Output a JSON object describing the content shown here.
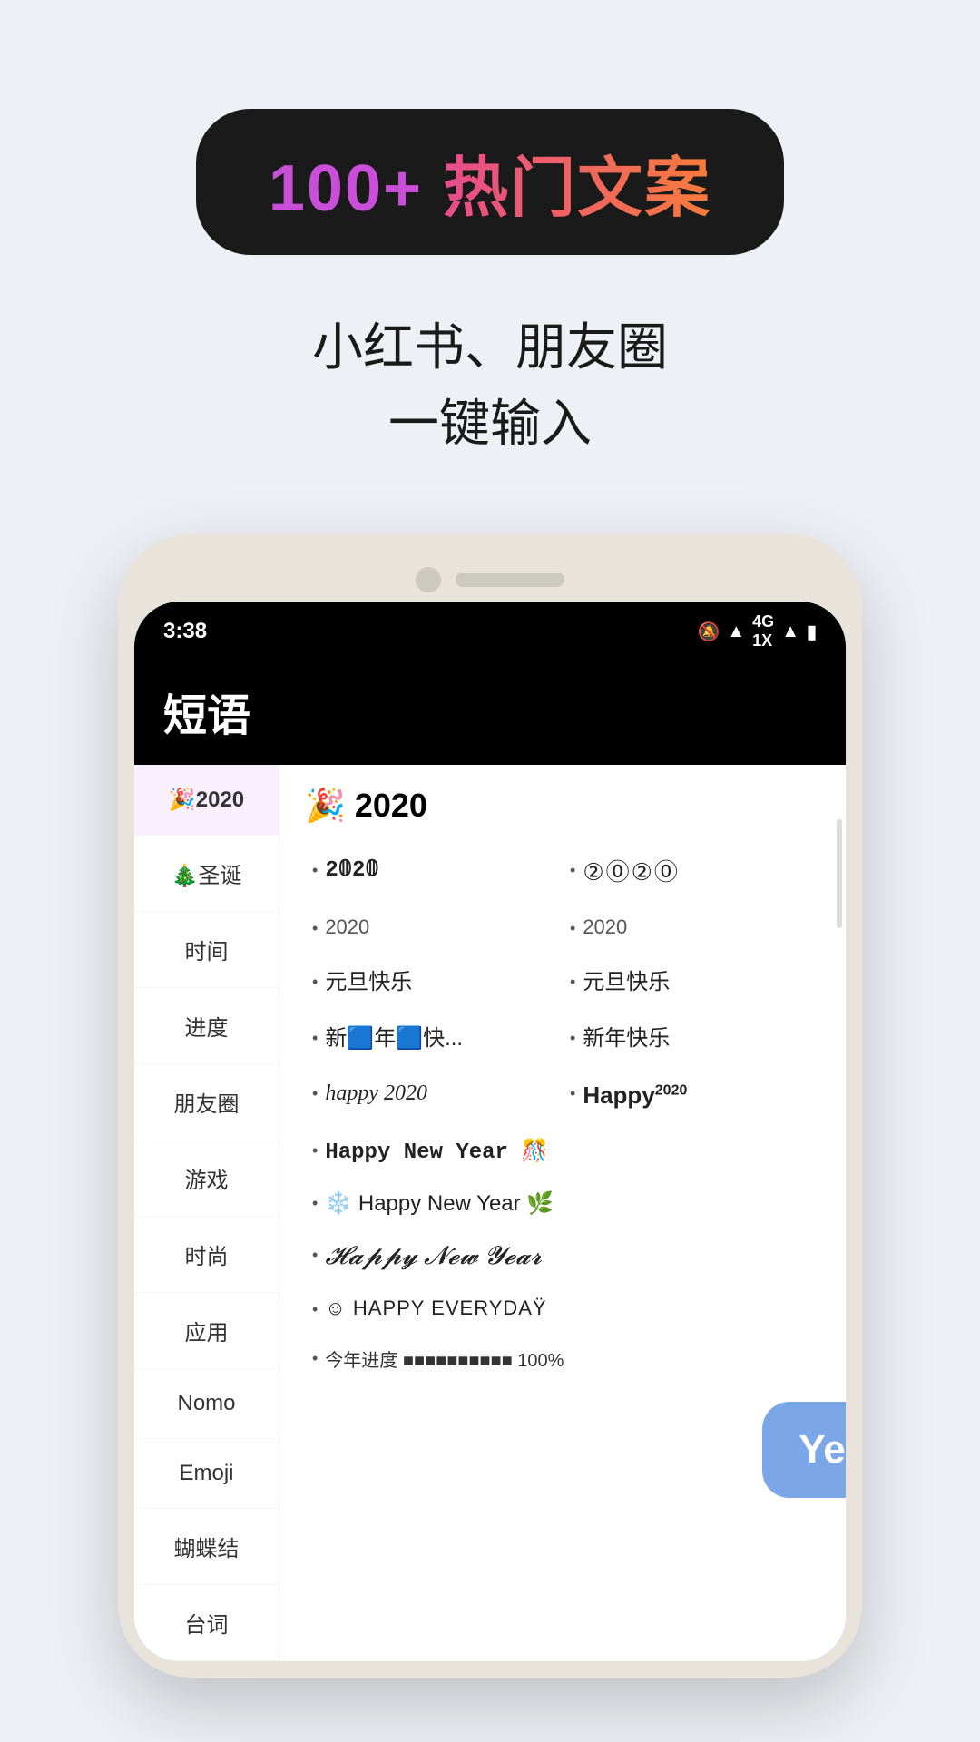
{
  "page": {
    "background": "#eef0f5"
  },
  "header": {
    "badge": {
      "num_text": "100+",
      "cn_text": " 热门文案"
    },
    "subtitle_line1": "小红书、朋友圈",
    "subtitle_line2": "一键输入"
  },
  "phone": {
    "status_bar": {
      "time": "3:38",
      "icons": "🔕 📶 4G 1x 📶 🔋"
    },
    "app_title": "短语",
    "sidebar": {
      "items": [
        {
          "id": "2020",
          "label": "🎉2020",
          "active": true
        },
        {
          "id": "christmas",
          "label": "🎄圣诞"
        },
        {
          "id": "time",
          "label": "时间"
        },
        {
          "id": "progress",
          "label": "进度"
        },
        {
          "id": "friends",
          "label": "朋友圈"
        },
        {
          "id": "games",
          "label": "游戏"
        },
        {
          "id": "fashion",
          "label": "时尚"
        },
        {
          "id": "apps",
          "label": "应用"
        },
        {
          "id": "nomo",
          "label": "Nomo"
        },
        {
          "id": "emoji",
          "label": "Emoji"
        },
        {
          "id": "bowknot",
          "label": "蝴蝶结"
        },
        {
          "id": "lines",
          "label": "台词"
        }
      ]
    },
    "content": {
      "section_title": "🎉 2020",
      "items": [
        {
          "col": 1,
          "text": "2𝟘2𝟘",
          "style": "typewriter"
        },
        {
          "col": 2,
          "text": "②⓪②⓪",
          "style": "circled"
        },
        {
          "col": 1,
          "text": "2020",
          "style": "small-cn"
        },
        {
          "col": 2,
          "text": "2020",
          "style": "small-cn"
        },
        {
          "col": 1,
          "text": "元旦快乐",
          "style": "normal"
        },
        {
          "col": 2,
          "text": "元旦快乐",
          "style": "normal"
        },
        {
          "col": 1,
          "text": "新🟦年🟦快...",
          "style": "normal"
        },
        {
          "col": 2,
          "text": "新年快乐",
          "style": "normal"
        },
        {
          "col": 1,
          "text": "happy 2020",
          "style": "script"
        },
        {
          "col": 2,
          "text": "Happy²⁰²⁰",
          "style": "bold-happy"
        },
        {
          "full": true,
          "text": "Happy New Year 🎊",
          "style": "typewriter"
        },
        {
          "full": true,
          "text": "❄️ Happy New Year 🌿",
          "style": "normal"
        },
        {
          "full": true,
          "text": "𝓗𝓪𝓹𝓹𝔂 𝓝𝓮𝔀 𝓨𝓮𝓪𝓻",
          "style": "cursive-happy"
        },
        {
          "full": true,
          "text": "☺ HAPPY EVERYDAŸ",
          "style": "smiley-happy"
        },
        {
          "full": true,
          "text": "今年进度 ■■■■■■■■■■ 100%",
          "style": "progress-bar"
        }
      ]
    }
  },
  "tooltip": {
    "text": "Year Pr"
  }
}
